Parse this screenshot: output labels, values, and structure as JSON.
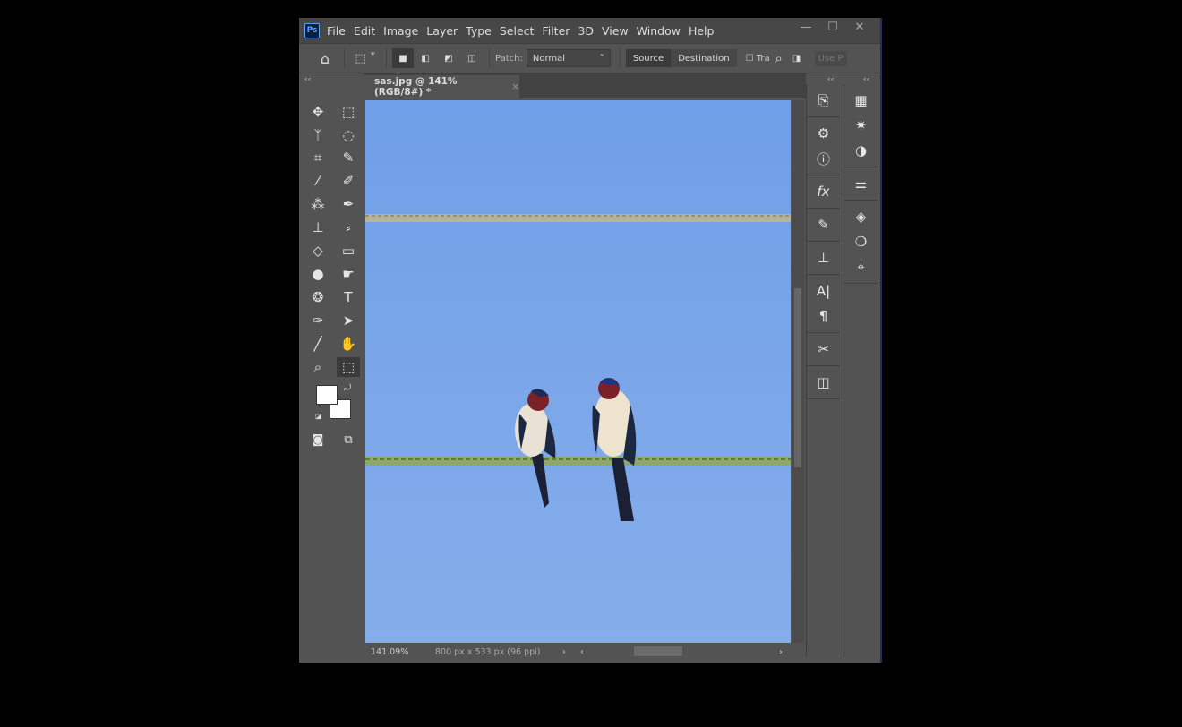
{
  "app": {
    "logo": "Ps",
    "menus": [
      "File",
      "Edit",
      "Image",
      "Layer",
      "Type",
      "Select",
      "Filter",
      "3D",
      "View",
      "Window",
      "Help"
    ],
    "window_buttons": {
      "minimize": "—",
      "maximize": "☐",
      "close": "✕"
    }
  },
  "options": {
    "patch_label": "Patch:",
    "patch_value": "Normal",
    "source": "Source",
    "destination": "Destination",
    "transparent": "Tra",
    "use_pattern": "Use P"
  },
  "document": {
    "tab_title": "sas.jpg @ 141% (RGB/8#) *",
    "close": "×"
  },
  "status": {
    "zoom": "141.09%",
    "info": "800 px x 533 px (96 ppi)"
  },
  "colors": {
    "sky": "#7aa7ea",
    "foreground": "#ffffff",
    "background": "#ffffff"
  }
}
